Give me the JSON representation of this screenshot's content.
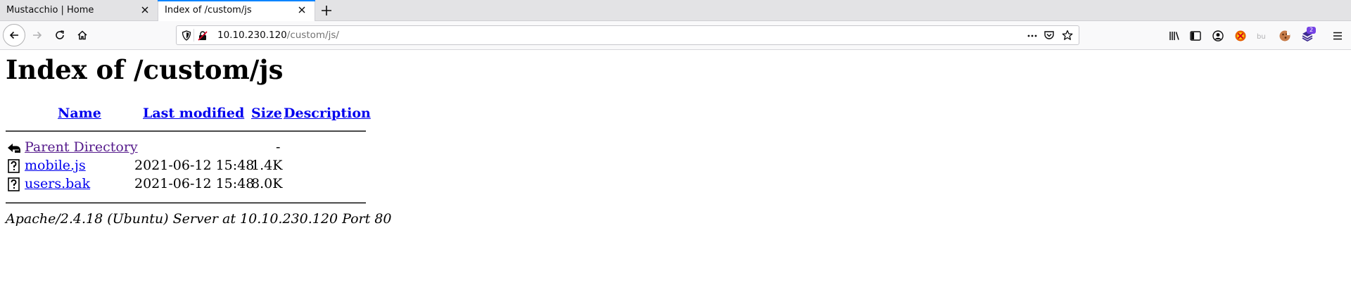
{
  "tabs": [
    {
      "title": "Mustacchio | Home",
      "active": false
    },
    {
      "title": "Index of /custom/js",
      "active": true
    }
  ],
  "urlbar": {
    "host": "10.10.230.120",
    "path": "/custom/js/"
  },
  "toolbar_icons": [
    "library-icon",
    "sidebar-icon",
    "account-icon",
    "extension-icon",
    "extension-icon",
    "extension-icon",
    "extension-icon",
    "menu-icon"
  ],
  "extension_badge": "2",
  "page": {
    "heading": "Index of /custom/js",
    "columns": {
      "name": "Name",
      "modified": "Last modified",
      "size": "Size",
      "description": "Description"
    },
    "rows": [
      {
        "icon": "back-arrow-icon",
        "name": "Parent Directory",
        "modified": "",
        "size": "-",
        "visited": true
      },
      {
        "icon": "unknown-file-icon",
        "name": "mobile.js",
        "modified": "2021-06-12 15:48",
        "size": "1.4K",
        "visited": false
      },
      {
        "icon": "unknown-file-icon",
        "name": "users.bak",
        "modified": "2021-06-12 15:48",
        "size": "8.0K",
        "visited": false
      }
    ],
    "address": "Apache/2.4.18 (Ubuntu) Server at 10.10.230.120 Port 80"
  },
  "colors": {
    "tab_accent": "#0a84ff",
    "link": "#0000ee",
    "visited_link": "#551a8b",
    "badge": "#7542e5"
  }
}
